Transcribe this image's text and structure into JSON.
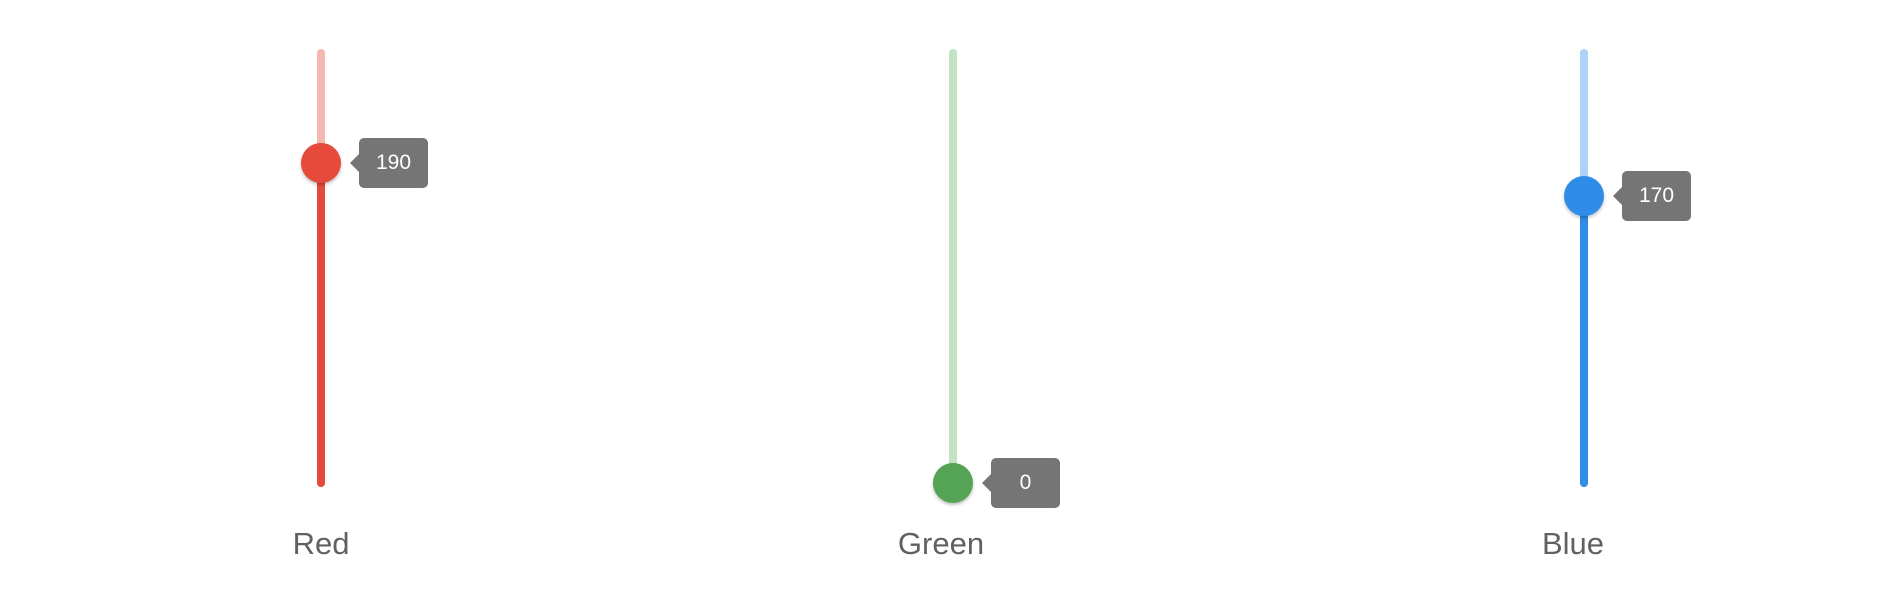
{
  "max": 255,
  "sliders": [
    {
      "label": "Red",
      "value": 190,
      "value_text": "190",
      "color": "#e64a3b",
      "track_color": "#f5b8b0"
    },
    {
      "label": "Green",
      "value": 0,
      "value_text": "0",
      "color": "#55a355",
      "track_color": "#c3e2c3"
    },
    {
      "label": "Blue",
      "value": 170,
      "value_text": "170",
      "color": "#2f8ce8",
      "track_color": "#add3fa"
    }
  ]
}
